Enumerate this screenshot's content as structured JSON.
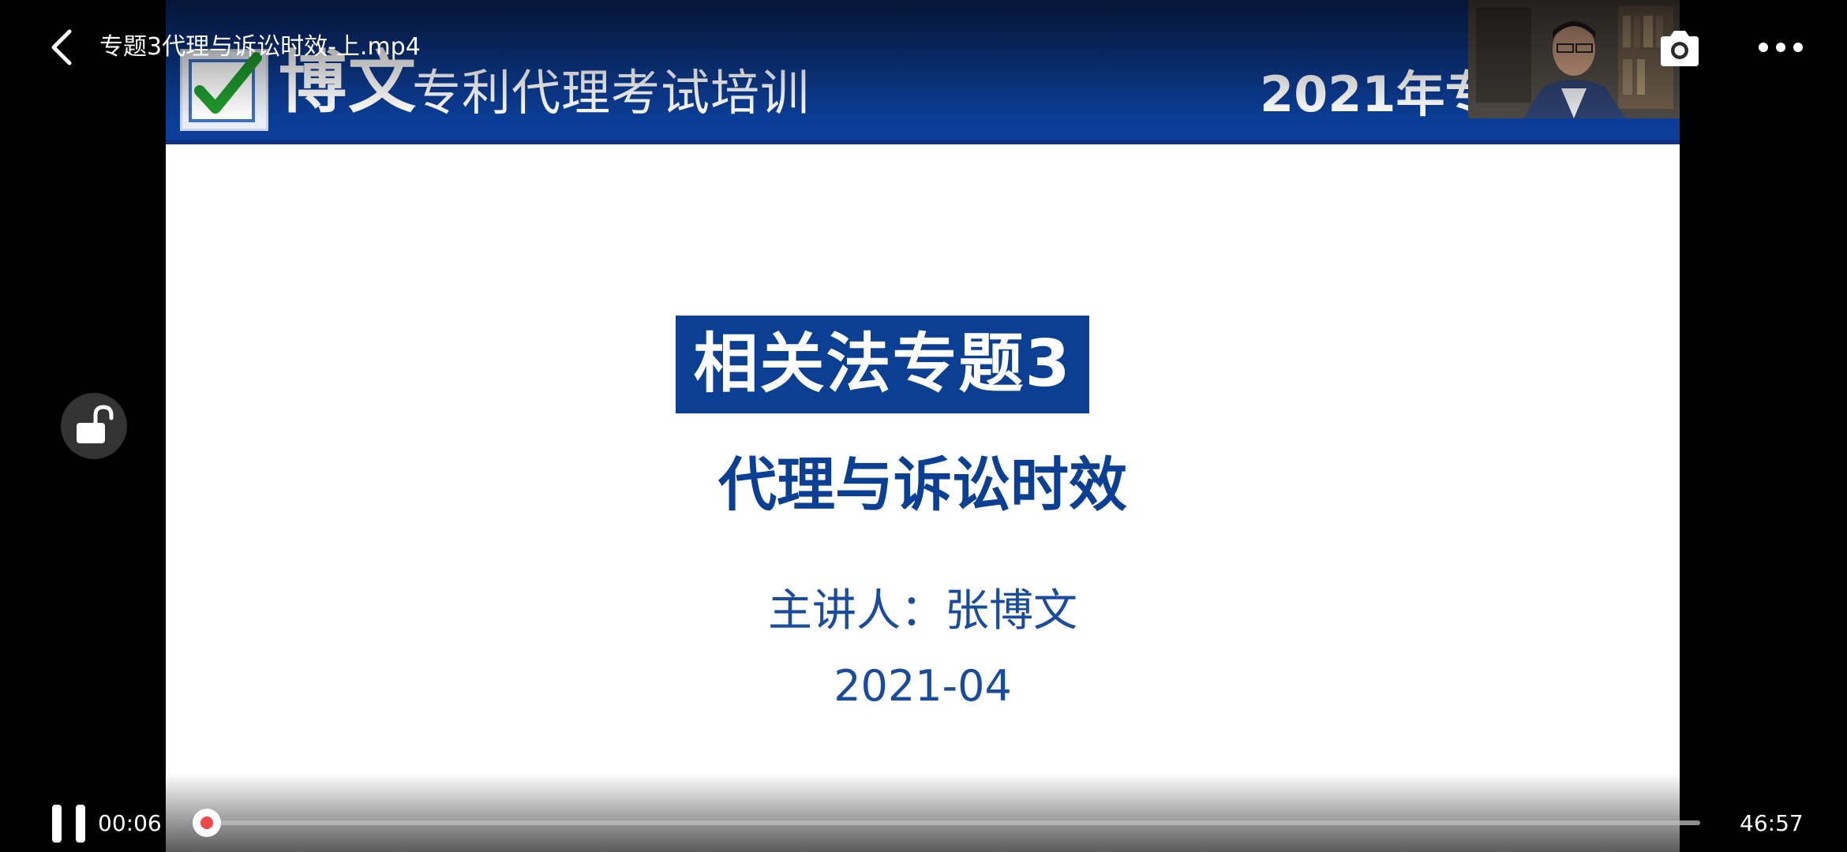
{
  "player": {
    "video_title": "专题3代理与诉讼时效-上.mp4",
    "current_time": "00:06",
    "total_time": "46:57",
    "progress": 0.002,
    "accent_color": "#f04848",
    "icons": {
      "back": "chevron-left-icon",
      "screenshot": "camera-icon",
      "more": "more-dots-icon",
      "lock": "unlock-icon",
      "pause": "pause-icon"
    }
  },
  "slide": {
    "brand": "博文",
    "brand_subtitle": "专利代理考试培训",
    "year_title": "2021年专",
    "topic_title": "相关法专题3",
    "topic_subtitle": "代理与诉讼时效",
    "lecturer": "主讲人：张博文",
    "date": "2021-04",
    "header_color": "#0b3a8f",
    "title_color": "#0b3f94"
  }
}
